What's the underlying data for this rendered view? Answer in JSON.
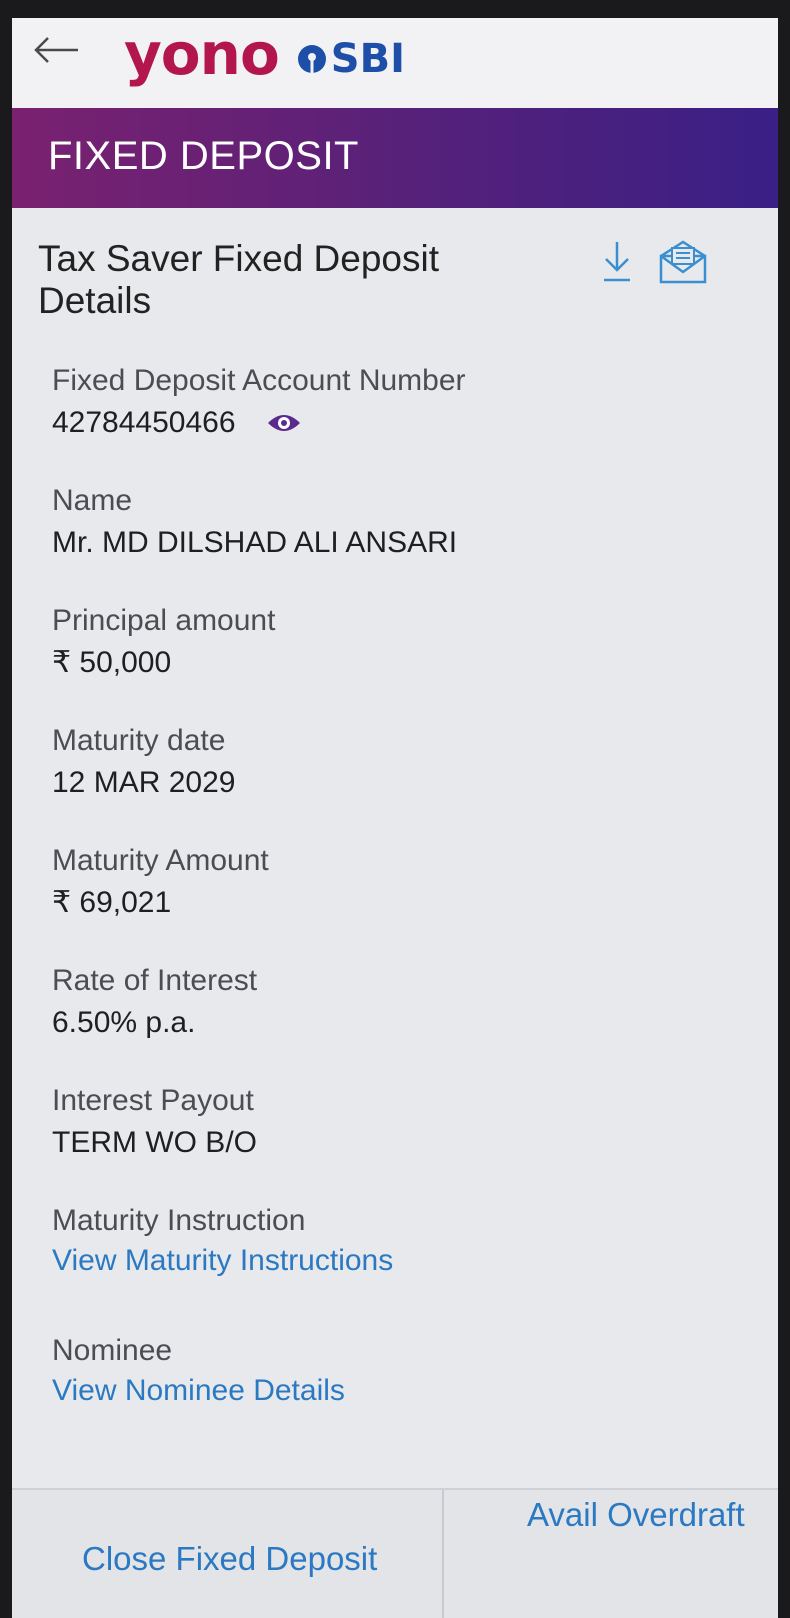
{
  "header": {
    "back_icon": "back-arrow-icon",
    "logo_yono": "yono",
    "logo_sbi": "SBI"
  },
  "title_band": {
    "title": "FIXED DEPOSIT"
  },
  "card": {
    "title": "Tax Saver Fixed Deposit Details",
    "actions": [
      "download-icon",
      "email-icon"
    ],
    "fields": [
      {
        "label": "Fixed Deposit Account Number",
        "value": "42784450466"
      },
      {
        "label": "Name",
        "value": "Mr. MD DILSHAD ALI ANSARI"
      },
      {
        "label": "Principal amount",
        "value": "₹ 50,000"
      },
      {
        "label": "Maturity date",
        "value": "12 MAR 2029"
      },
      {
        "label": "Maturity Amount",
        "value": "₹ 69,021"
      },
      {
        "label": "Rate of Interest",
        "value": "6.50% p.a."
      },
      {
        "label": "Interest Payout",
        "value": "TERM WO B/O"
      },
      {
        "label": "Maturity Instruction",
        "link": "View Maturity Instructions"
      },
      {
        "label": "Nominee",
        "link": "View Nominee Details"
      }
    ]
  },
  "bottom_actions": {
    "close_label": "Close Fixed Deposit",
    "overdraft_label": "Avail Overdraft"
  },
  "colors": {
    "brand_purple": "#55217a",
    "yono_magenta": "#b3164d",
    "sbi_blue": "#1e4fa8",
    "link_blue": "#2a79c2"
  }
}
